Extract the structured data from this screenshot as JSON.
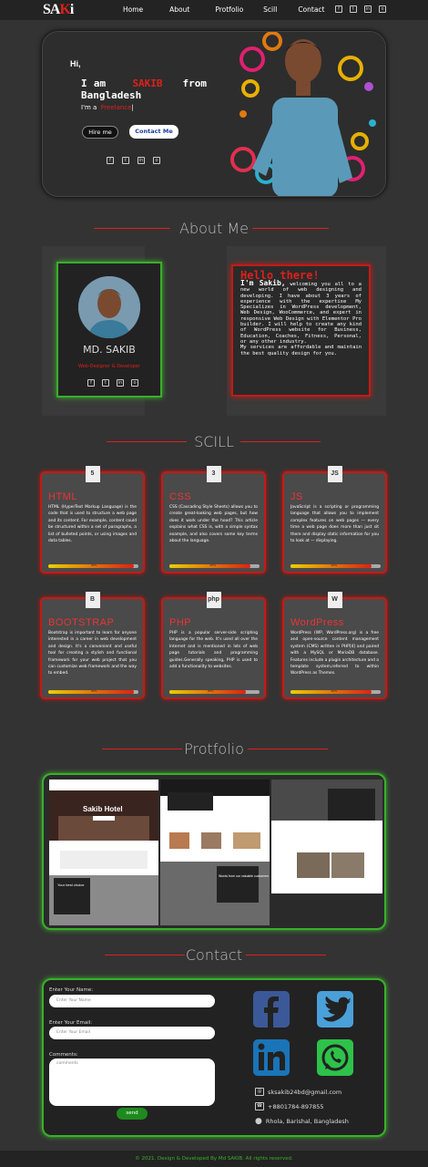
{
  "nav": {
    "logo_a": "SA",
    "logo_k": "K",
    "logo_b": "i",
    "items": [
      "Home",
      "About",
      "Protfolio",
      "Scill",
      "Contact"
    ],
    "social_icons": [
      "facebook-icon",
      "twitter-icon",
      "linkedin-icon",
      "instagram-icon"
    ]
  },
  "hero": {
    "hi": "Hi,",
    "i_am": "I am",
    "name": "SAKIB",
    "from": "from Bangladesh",
    "im_a": "I'm a",
    "role": "Freelance",
    "hire_button": "Hire me",
    "contact_button": "Contact Me"
  },
  "about": {
    "title": "About Me",
    "profile_name": "MD. SAKIB",
    "profile_role": "Web-Designer & Developer",
    "hello_heading": "Hello there!",
    "intro_name": "I'm Sakib,",
    "intro_text": " welcoming you all to a new world of web designing and developing. I have about 3 years of experience with the expertise My Specializes in WordPress development, Web Design, WooCommerce, and expert in responsive Web Design with Elementor Pro builder. I will help to create any kind of WordPress website for Business, Education, Coaches, Fitness, Personal, or any other industry.",
    "intro_text2": "My services are affordable and maintain the best quality design for you."
  },
  "skills": {
    "title": "SCILL",
    "cards": [
      {
        "name": "HTML",
        "icon": "5",
        "text": "HTML (HyperText Markup Language) is the code that is used to structure a web page and its content. For example, content could be structured within a set of paragraphs, a list of bulleted points, or using images and data tables.",
        "level": 95,
        "label": "95%"
      },
      {
        "name": "CSS",
        "icon": "3",
        "text": "CSS (Cascading Style Sheets) allows you to create great-looking web pages, but how does it work under the hood? This article explains what CSS is, with a simple syntax example, and also covers some key terms about the language.",
        "level": 90,
        "label": "90%"
      },
      {
        "name": "JS",
        "icon": "JS",
        "text": "JavaScript is a scripting or programming language that allows you to implement complex features on web pages — every time a web page does more than just sit there and display static information for you to look at — displaying.",
        "level": 90,
        "label": "90%"
      },
      {
        "name": "BOOTSTRAP",
        "icon": "B",
        "text": "Bootstrap is important to learn for anyone interested in a career in web development and design. It's a convenient and useful tool for creating a stylish and functional framework for your web project that you can customize web framework and the way to embed.",
        "level": 95,
        "label": "95%"
      },
      {
        "name": "PHP",
        "icon": "php",
        "text": "PHP is a popular server-side scripting language for the web. It's used all over the Internet and is mentioned in lots of web page tutorials and programming guides.Generally speaking, PHP is used to add a functionality to websites.",
        "level": 85,
        "label": "85%"
      },
      {
        "name": "WordPress",
        "icon": "W",
        "text": "WordPress (WP, WordPress.org) is a free and open-source content management system (CMS) written in PHP[4] and paired with a MySQL or MariaDB database. Features include a plugin architecture and a template system,referred to within WordPress as Themes.",
        "level": 90,
        "label": "90%"
      }
    ]
  },
  "portfolio": {
    "title": "Protfolio",
    "hotel_title": "Sakib Hotel",
    "best_choice": "Your best choice",
    "words": "Words from our valuable customers"
  },
  "contact": {
    "title": "Contact",
    "name_label": "Enter Your Name:",
    "name_placeholder": "Enter Your Name",
    "email_label": "Enter Your Email:",
    "email_placeholder": "Enter Your Email",
    "comments_label": "Comments:",
    "comments_placeholder": "comments",
    "send": "send",
    "email": "sksakib24bd@gmail.com",
    "phone": "+8801784-897855",
    "address": "Rhola, Barishal, Bangladesh"
  },
  "footer": "© 2021. Design & Developed By Md SAKIB. All rights reserved."
}
